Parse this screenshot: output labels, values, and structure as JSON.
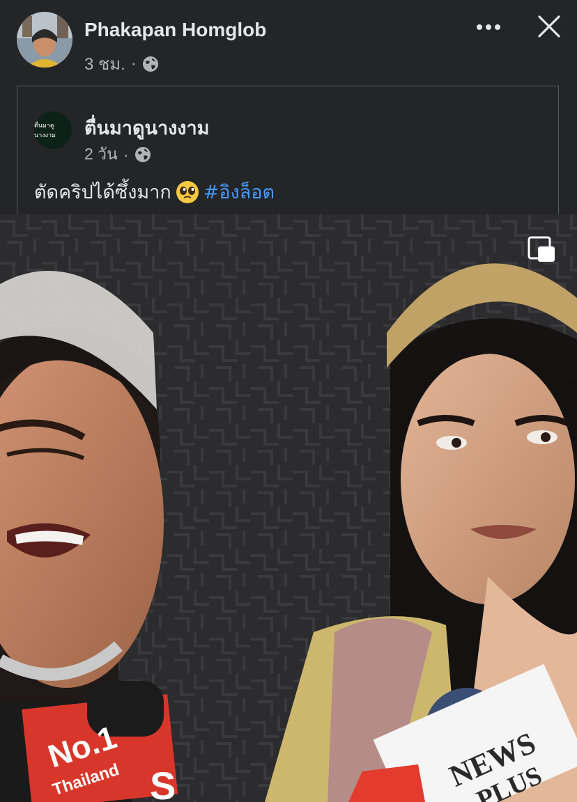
{
  "post": {
    "author": "Phakapan Homglob",
    "time": "3 ชม.",
    "separator": "·",
    "privacy_icon": "globe-icon",
    "more_icon": "more-options-icon",
    "close_icon": "close-icon"
  },
  "shared": {
    "page_name": "ตื่นมาดูนางงาม",
    "avatar_text": "ตื่นมาดูนางงาม",
    "time": "2 วัน",
    "separator": "·",
    "privacy_icon": "globe-icon",
    "text": "ตัดคริปได้ซึ้งมาก",
    "emoji": "pleading-face-emoji",
    "hashtag": "#อิงล็อต"
  },
  "media": {
    "type": "video-frame",
    "pip_icon": "picture-in-picture-icon",
    "mic_flag_left_line1": "No.1",
    "mic_flag_left_line2": "Thailand",
    "mic_flag_left_partial": "S",
    "mic_flag_right_line1": "NEWS",
    "mic_flag_right_line2": "PLUS"
  },
  "colors": {
    "background": "#242526",
    "text_primary": "#e4e6eb",
    "text_secondary": "#b0b3b8",
    "hashtag": "#4599ff"
  }
}
